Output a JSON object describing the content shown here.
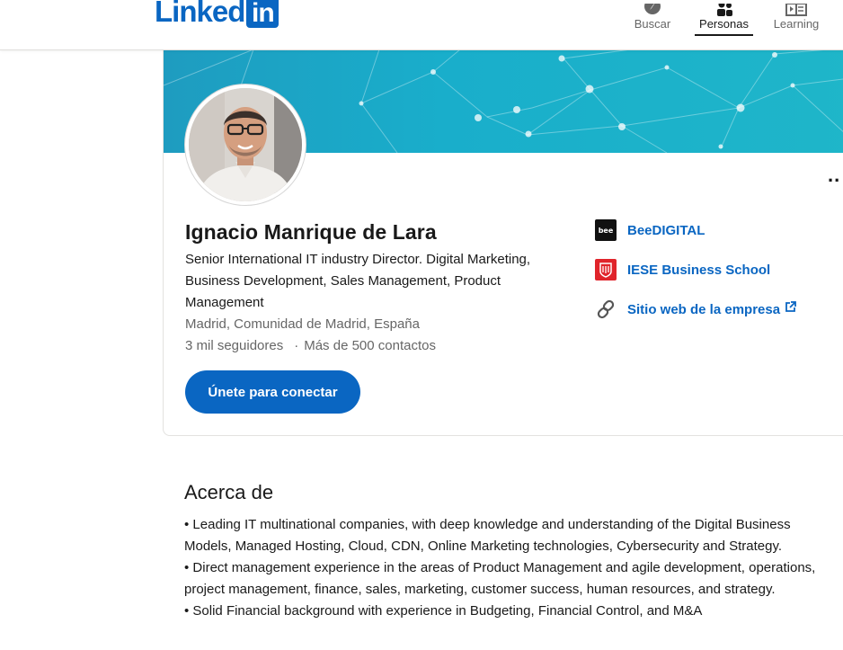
{
  "header": {
    "logo_text": "Linked",
    "logo_badge": "in",
    "nav": [
      {
        "label": "Buscar",
        "icon": "compass-icon"
      },
      {
        "label": "Personas",
        "icon": "people-icon",
        "active": true
      },
      {
        "label": "Learning",
        "icon": "learning-icon"
      }
    ]
  },
  "profile": {
    "name": "Ignacio Manrique de Lara",
    "headline": "Senior International IT industry Director. Digital Marketing, Business Development, Sales Management, Product Management",
    "location": "Madrid, Comunidad de Madrid, España",
    "followers": "3 mil seguidores",
    "contacts": "Más de 500 contactos",
    "separator": "·",
    "connect_label": "Únete para conectar",
    "more_label": ".."
  },
  "side_links": [
    {
      "label": "BeeDIGITAL",
      "icon": "beedigital-logo-icon"
    },
    {
      "label": "IESE Business School",
      "icon": "iese-logo-icon"
    },
    {
      "label": "Sitio web de la empresa",
      "icon": "link-icon"
    }
  ],
  "about": {
    "title": "Acerca de",
    "paragraphs": [
      "• Leading IT multinational companies, with deep knowledge and understanding of the Digital Business Models, Managed Hosting, Cloud, CDN, Online Marketing technologies, Cybersecurity and Strategy.",
      "• Direct management experience in the areas of Product Management and agile development, operations, project management, finance, sales, marketing, customer success, human resources, and strategy.",
      "• Solid Financial background with experience in Budgeting, Financial Control, and M&A"
    ]
  },
  "colors": {
    "brand_blue": "#0a66c2",
    "banner": "#19aecb",
    "muted_text": "#666666"
  }
}
